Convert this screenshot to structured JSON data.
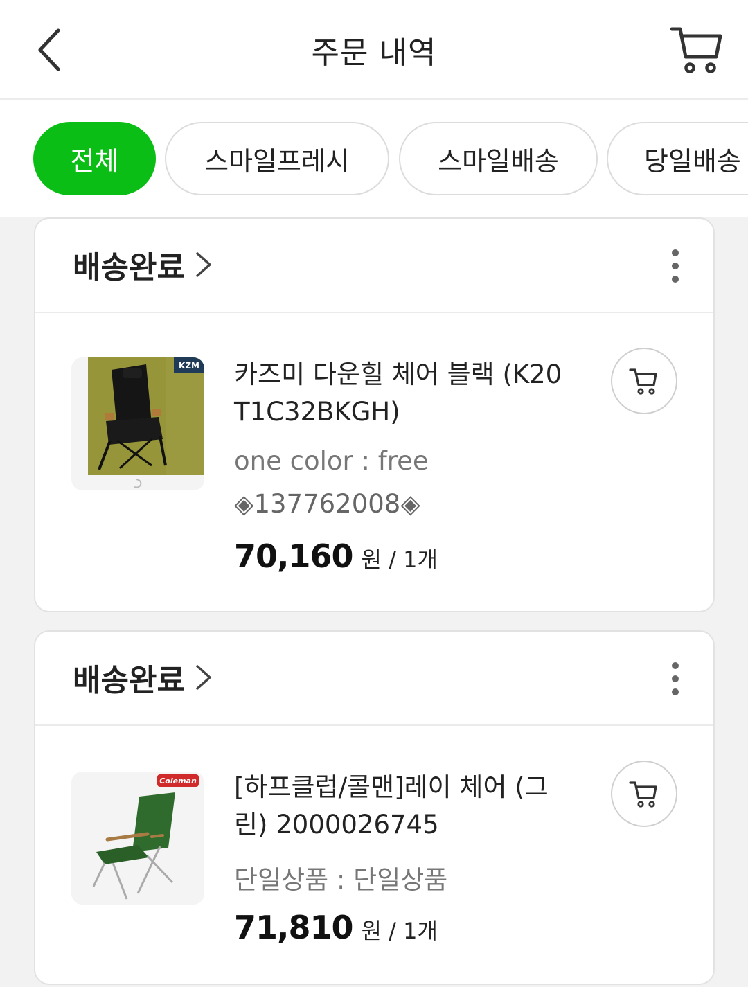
{
  "header": {
    "title": "주문 내역",
    "back_icon": "chevron-left-icon",
    "cart_icon": "cart-icon"
  },
  "filters": [
    {
      "label": "전체",
      "active": true
    },
    {
      "label": "스마일프레시",
      "active": false
    },
    {
      "label": "스마일배송",
      "active": false
    },
    {
      "label": "당일배송",
      "active": false
    }
  ],
  "colors": {
    "accent": "#0abe16",
    "chip_border": "#dcdcdc",
    "background": "#f2f2f2"
  },
  "orders": [
    {
      "status": "배송완료",
      "product": {
        "name": "카즈미 다운힐 체어 블랙 (K20T1C32BKGH)",
        "name_line1": "카즈미 다운힐 체어 블랙 (K20",
        "name_line2": "T1C32BKGH)",
        "option": "one color : free",
        "code": "◈137762008◈",
        "price": "70,160",
        "price_unit": "원 / 1개",
        "brand_badge": "KZM",
        "image": "black-camping-chair"
      }
    },
    {
      "status": "배송완료",
      "product": {
        "name": "[하프클럽/콜맨]레이 체어 (그린) 2000026745",
        "name_line1": "[하프클럽/콜맨]레이 체어 (그",
        "name_line2": "린) 2000026745",
        "option": "단일상품 : 단일상품",
        "price": "71,810",
        "price_unit": "원 / 1개",
        "brand_badge": "Coleman",
        "image": "green-camping-chair"
      }
    }
  ]
}
